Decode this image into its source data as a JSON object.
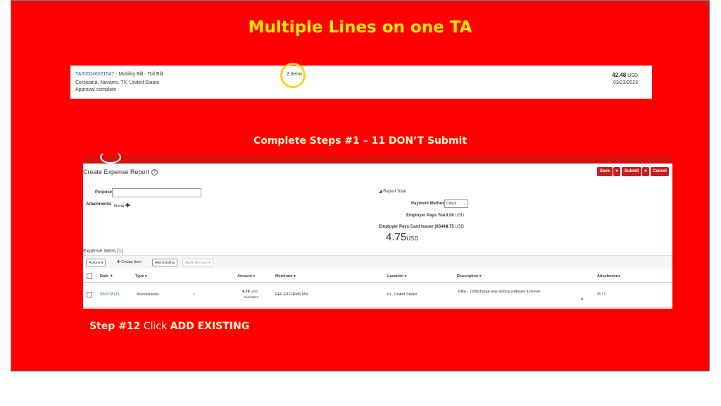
{
  "slide": {
    "title": "Multiple Lines on one TA",
    "steps_title": "Complete Steps #1 – 11   DON’T Submit",
    "step12_prefix": "Step #12",
    "step12_mid": " Click ",
    "step12_bold": "ADD EXISTING"
  },
  "ta": {
    "id": "TA000046071547",
    "desc": " - Mobility Bill - Toll Bill",
    "location": "Corsicana, Navarro, TX, United States",
    "status": "Approval complete",
    "items": "2 items",
    "amount": "42.48",
    "currency": "USD",
    "date": "03/23/2023"
  },
  "report": {
    "title": "Create Expense Report",
    "save": "Save",
    "submit": "Submit",
    "cancel": "Cancel",
    "purpose_label": "Purpose",
    "attachments_label": "Attachments",
    "attachments_value": "None",
    "report_total_label": "Report Total",
    "payment_method_label": "Payment Method",
    "payment_method_value": "Check",
    "employer_pays_you_label": "Employer Pays You",
    "employer_pays_you_value": "0.00",
    "employer_pays_you_currency": "USD",
    "employer_pays_card_label": "Employer Pays Card Issuer (6544)",
    "employer_pays_card_value": "4.75",
    "employer_pays_card_currency": "USD",
    "total_amount": "4.75",
    "total_currency": "USD"
  },
  "items_section": {
    "header": "Expense Items (1)",
    "actions": "Actions",
    "create_item": "Create Item",
    "add_existing": "Add Existing",
    "apply_account": "Apply Account",
    "columns": [
      "Date",
      "Type",
      "Amount",
      "Merchant",
      "Location",
      "Description",
      "Attachments"
    ],
    "row": {
      "date": "03/07/2023",
      "type": "Miscellaneous",
      "amount": "4.75",
      "amount_currency": "USD",
      "card": "Card 6544",
      "merchant": "EFILE/FORMSTAX",
      "location": "FL, United States",
      "description": "Efile - 1099charge was during software turnover",
      "attachments": "(1)"
    }
  },
  "colors": {
    "slide_bg": "#ff0000",
    "title": "#ffe600",
    "highlight_circle": "#f7d21a",
    "button_red": "#c62020"
  }
}
